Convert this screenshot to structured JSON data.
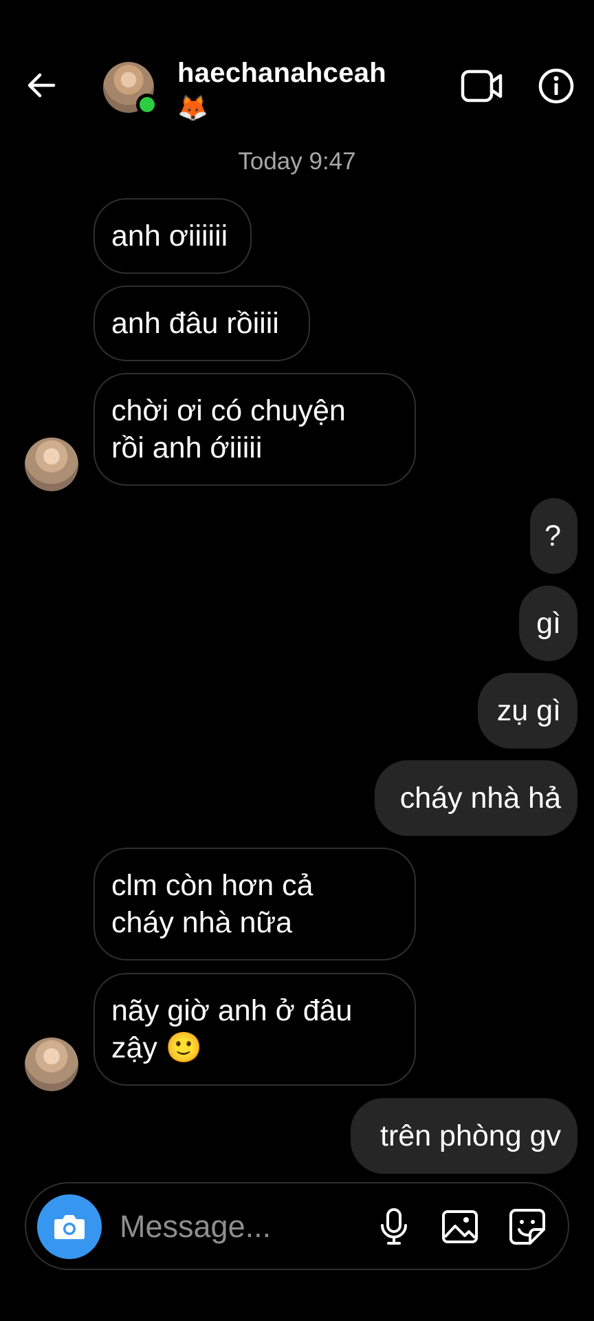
{
  "header": {
    "username": "haechanahceah",
    "status_emoji": "🦊",
    "online": true,
    "online_color": "#2ecc40",
    "icons": {
      "back": "back-arrow-icon",
      "video": "video-call-icon",
      "info": "info-icon"
    }
  },
  "timestamp": "Today 9:47",
  "messages": [
    {
      "side": "in",
      "text": "anh ơiiiiii"
    },
    {
      "side": "in",
      "text": "anh đâu rồiiii"
    },
    {
      "side": "in",
      "text": "chời ơi có chuyện\nrồi anh ớiiiii"
    },
    {
      "side": "out",
      "text": "?"
    },
    {
      "side": "out",
      "text": "gì"
    },
    {
      "side": "out",
      "text": "zụ gì"
    },
    {
      "side": "out",
      "text": "cháy nhà hả"
    },
    {
      "side": "in",
      "text": "clm còn hơn cả\ncháy nhà nữa"
    },
    {
      "side": "in",
      "text": "nãy giờ anh ở đâu\nzậy 🙂"
    },
    {
      "side": "out",
      "text": "trên phòng gv"
    }
  ],
  "composer": {
    "placeholder": "Message...",
    "accent_color": "#3797f0",
    "icons": {
      "camera": "camera-icon",
      "mic": "microphone-icon",
      "gallery": "gallery-icon",
      "sticker": "sticker-icon"
    }
  }
}
